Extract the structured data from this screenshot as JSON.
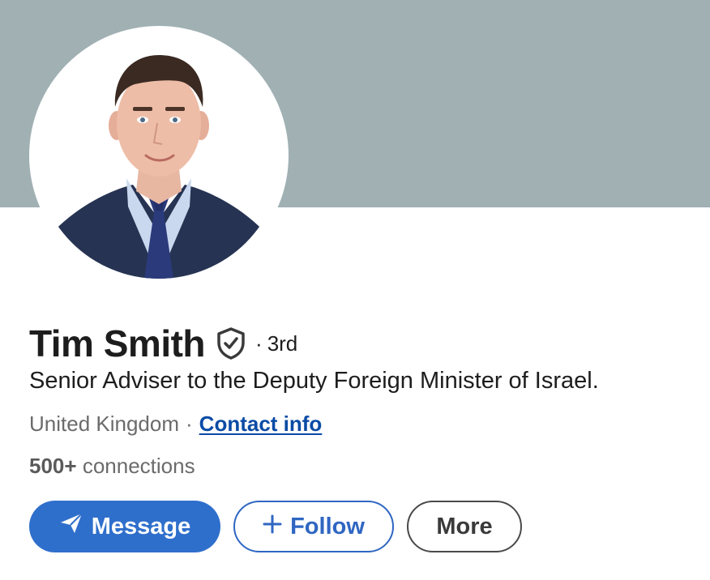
{
  "profile": {
    "name": "Tim Smith",
    "degree_separator": "·",
    "degree": "3rd",
    "headline": "Senior Adviser to the Deputy Foreign Minister of Israel.",
    "location": "United Kingdom",
    "location_separator": "·",
    "contact_info_label": "Contact info",
    "connections_count": "500+",
    "connections_label": "connections",
    "verified_icon": "verified-shield-icon",
    "avatar_icon": "profile-photo"
  },
  "actions": {
    "message_label": "Message",
    "message_icon": "paper-plane-icon",
    "follow_label": "Follow",
    "follow_icon": "plus-icon",
    "more_label": "More"
  },
  "colors": {
    "banner": "#a0b0b3",
    "primary": "#2f6fcc",
    "link": "#0a4ba5"
  }
}
